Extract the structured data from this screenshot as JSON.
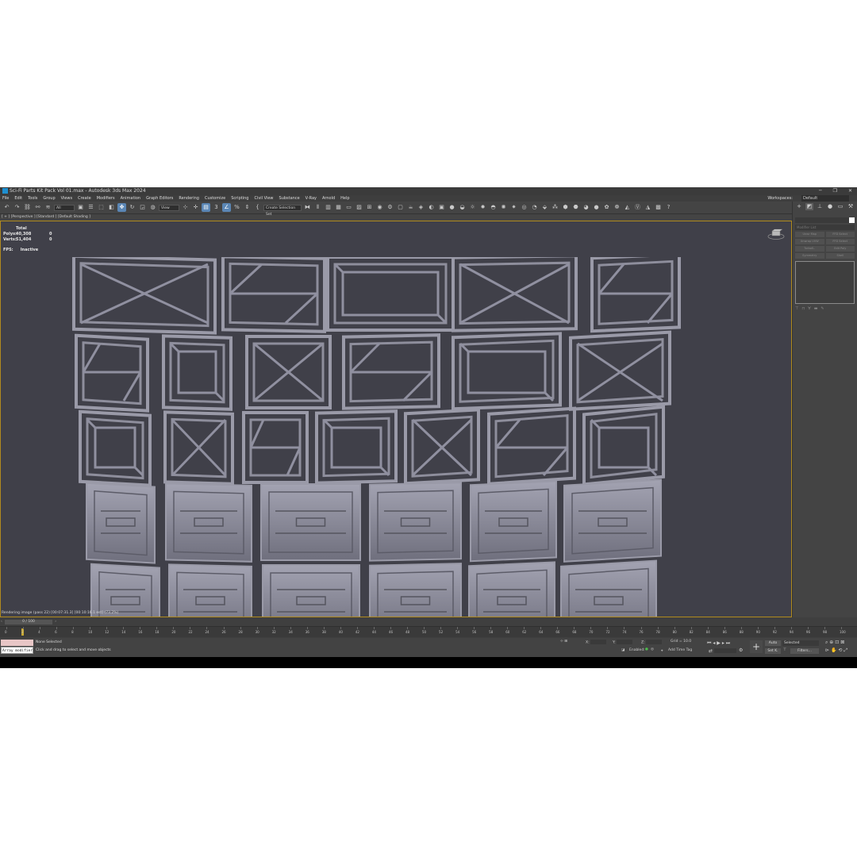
{
  "window": {
    "title": "Sci-Fi Parts Kit Pack Vol 01.max - Autodesk 3ds Max 2024"
  },
  "menu": {
    "items": [
      "File",
      "Edit",
      "Tools",
      "Group",
      "Views",
      "Create",
      "Modifiers",
      "Animation",
      "Graph Editors",
      "Rendering",
      "Customize",
      "Scripting",
      "Civil View",
      "Substance",
      "V-Ray",
      "Arnold",
      "Help"
    ],
    "workspaces_label": "Workspaces:",
    "workspace_value": "Default"
  },
  "toolbar": {
    "selection_filter": "All",
    "ref_coord": "View",
    "selection_set_placeholder": "Create Selection Set"
  },
  "viewport": {
    "label": "[ + ] [Perspective ] [Standard ] [Default Shading ]",
    "stats": {
      "total_label": "Total",
      "polys_label": "Polys:",
      "polys_value": "40,308",
      "polys_sel": "0",
      "verts_label": "Verts:",
      "verts_value": "51,404",
      "verts_sel": "0",
      "fps_label": "FPS:",
      "fps_value": "Inactive"
    },
    "render_status": "Rendering image (pass 22) [00:07:31.3] [00:10:16.1 est]     (73.2%)"
  },
  "command_panel": {
    "modifier_list": "Modifier List",
    "modifier_buttons": [
      "Unwr Map",
      "FFD Select",
      "Unwrap UVW",
      "FFD Select",
      "TurboS..",
      "Edit Poly",
      "Symmetry",
      "Shell"
    ]
  },
  "timeline": {
    "frame_display": "0 / 100",
    "ticks": [
      "0",
      "2",
      "4",
      "6",
      "8",
      "10",
      "12",
      "14",
      "16",
      "18",
      "20",
      "22",
      "24",
      "26",
      "28",
      "30",
      "32",
      "34",
      "36",
      "38",
      "40",
      "42",
      "44",
      "46",
      "48",
      "50",
      "52",
      "54",
      "56",
      "58",
      "60",
      "62",
      "64",
      "66",
      "68",
      "70",
      "72",
      "74",
      "76",
      "78",
      "80",
      "82",
      "84",
      "86",
      "88",
      "90",
      "92",
      "94",
      "96",
      "98",
      "100"
    ]
  },
  "status": {
    "maxscript_text": "Array modifier",
    "selection_status": "None Selected",
    "prompt": "Click and drag to select and move objects",
    "x_label": "X:",
    "y_label": "Y:",
    "z_label": "Z:",
    "grid": "Grid = 10.0",
    "enabled_label": "Enabled:",
    "add_time_tag": "Add Time Tag",
    "auto_label": "Auto",
    "selected_label": "Selected",
    "set_k_label": "Set K.",
    "filters_label": "Filters..."
  },
  "colors": {
    "viewport_bg": "#404049",
    "active_border": "#b08a1e",
    "ui_bg": "#444444",
    "accent_blue": "#5a86b5",
    "panel_metal": "#8a8a98"
  }
}
